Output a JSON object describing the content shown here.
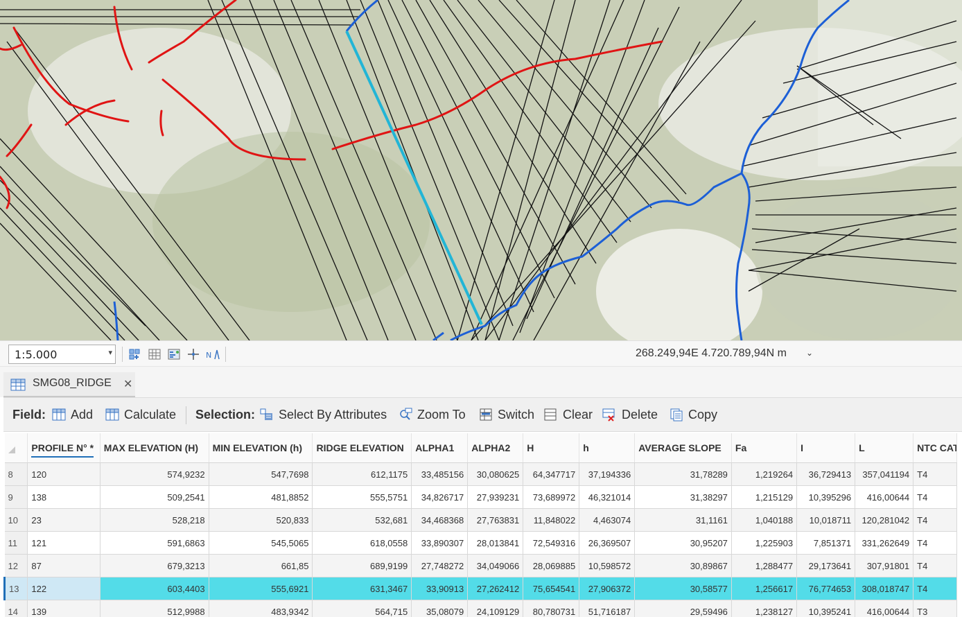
{
  "map": {
    "scale": "1:5.000",
    "coordinates": "268.249,94E 4.720.789,94N m",
    "colors": {
      "terrain": "#cfd5c1",
      "ridge_lines": "#e01414",
      "profile_lines": "#111111",
      "boundary": "#1c5fd6",
      "selected_profile": "#22b5d6"
    }
  },
  "status_tools": [
    "scale-dropdown-icon",
    "snapping-icon",
    "grid-icon",
    "correction-icon",
    "crosshair-icon",
    "north-arrow-icon"
  ],
  "table_tab": {
    "label": "SMG08_RIDGE",
    "close": "✕"
  },
  "toolbar": {
    "field_label": "Field:",
    "add_label": "Add",
    "calculate_label": "Calculate",
    "selection_label": "Selection:",
    "select_by_attributes_label": "Select By Attributes",
    "zoom_to_label": "Zoom To",
    "switch_label": "Switch",
    "clear_label": "Clear",
    "delete_label": "Delete",
    "copy_label": "Copy"
  },
  "table": {
    "columns": [
      "PROFILE N° *",
      "MAX ELEVATION (H)",
      "MIN ELEVATION (h)",
      "RIDGE ELEVATION",
      "ALPHA1",
      "ALPHA2",
      "H",
      "h",
      "AVERAGE SLOPE",
      "Fa",
      "I",
      "L",
      "NTC CAT"
    ],
    "rows": [
      {
        "n": "8",
        "cells": [
          "120",
          "574,9232",
          "547,7698",
          "612,1175",
          "33,485156",
          "30,080625",
          "64,347717",
          "37,194336",
          "31,78289",
          "1,219264",
          "36,729413",
          "357,041194",
          "T4"
        ]
      },
      {
        "n": "9",
        "cells": [
          "138",
          "509,2541",
          "481,8852",
          "555,5751",
          "34,826717",
          "27,939231",
          "73,689972",
          "46,321014",
          "31,38297",
          "1,215129",
          "10,395296",
          "416,00644",
          "T4"
        ]
      },
      {
        "n": "10",
        "cells": [
          "23",
          "528,218",
          "520,833",
          "532,681",
          "34,468368",
          "27,763831",
          "11,848022",
          "4,463074",
          "31,1161",
          "1,040188",
          "10,018711",
          "120,281042",
          "T4"
        ]
      },
      {
        "n": "11",
        "cells": [
          "121",
          "591,6863",
          "545,5065",
          "618,0558",
          "33,890307",
          "28,013841",
          "72,549316",
          "26,369507",
          "30,95207",
          "1,225903",
          "7,851371",
          "331,262649",
          "T4"
        ]
      },
      {
        "n": "12",
        "cells": [
          "87",
          "679,3213",
          "661,85",
          "689,9199",
          "27,748272",
          "34,049066",
          "28,069885",
          "10,598572",
          "30,89867",
          "1,288477",
          "29,173641",
          "307,91801",
          "T4"
        ]
      },
      {
        "n": "13",
        "cells": [
          "122",
          "603,4403",
          "555,6921",
          "631,3467",
          "33,90913",
          "27,262412",
          "75,654541",
          "27,906372",
          "30,58577",
          "1,256617",
          "76,774653",
          "308,018747",
          "T4"
        ],
        "selected": true
      },
      {
        "n": "14",
        "cells": [
          "139",
          "512,9988",
          "483,9342",
          "564,715",
          "35,08079",
          "24,109129",
          "80,780731",
          "51,716187",
          "29,59496",
          "1,238127",
          "10,395241",
          "416,00644",
          "T3"
        ]
      }
    ]
  }
}
